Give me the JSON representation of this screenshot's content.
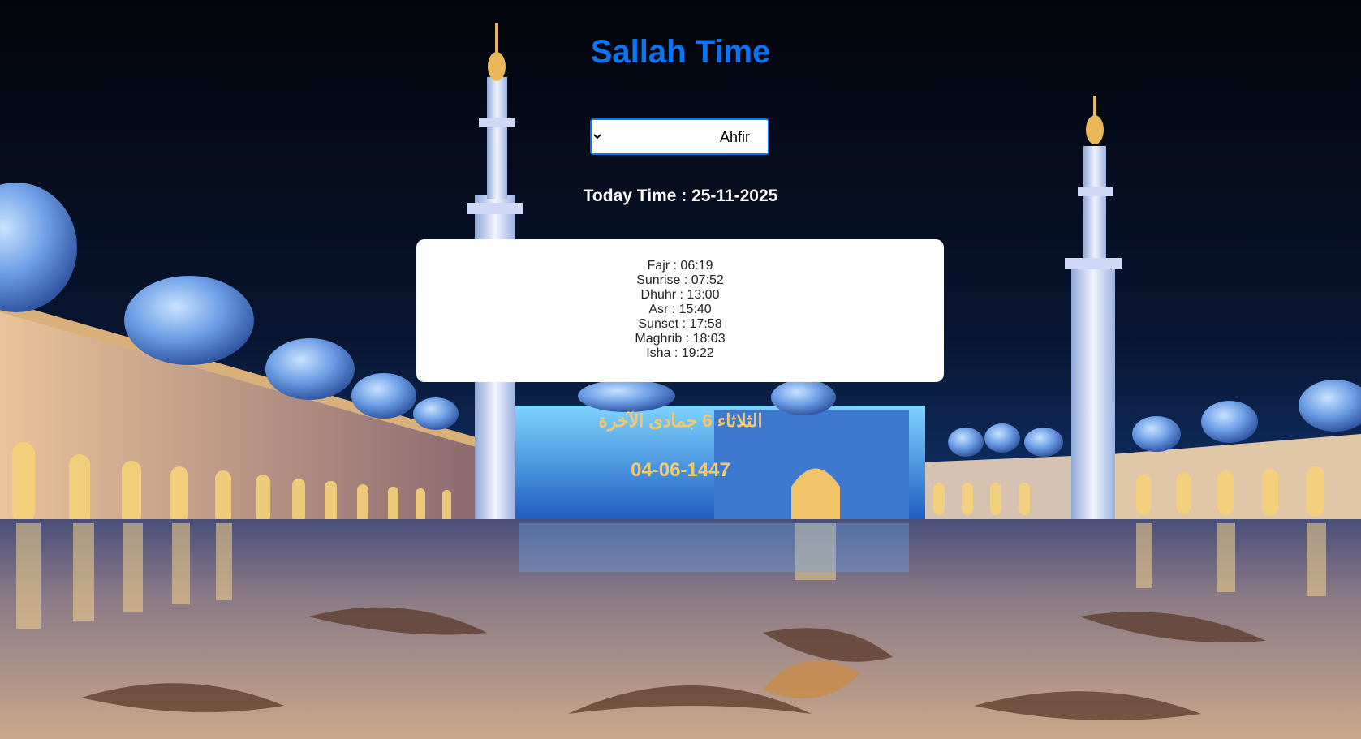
{
  "app": {
    "title": "Sallah Time",
    "title_color": "#0b74f0"
  },
  "city_select": {
    "value": "Ahfir",
    "options": [
      "Ahfir"
    ]
  },
  "today": {
    "text": "Today Time : 25-11-2025"
  },
  "prayer_times": [
    "Fajr : 06:19",
    "Sunrise : 07:52",
    "Dhuhr : 13:00",
    "Asr : 15:40",
    "Sunset : 17:58",
    "Maghrib : 18:03",
    "Isha : 19:22"
  ],
  "hijri": {
    "text": "الثلاثاء 6 جمادى الآخرة",
    "numeric": "04-06-1447",
    "color": "#f3c96c"
  },
  "background": {
    "image": "mosque-night-photo"
  }
}
